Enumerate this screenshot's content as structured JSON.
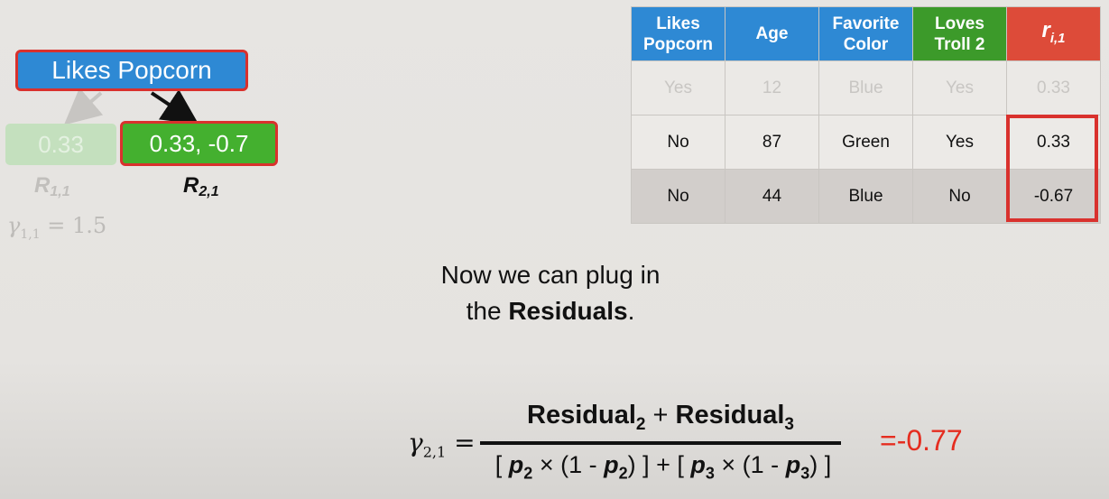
{
  "tree": {
    "root_label": "Likes Popcorn",
    "leaf_left_value": "0.33",
    "leaf_right_value": "0.33, -0.7",
    "leaf_left_name": "R",
    "leaf_left_sub": "1,1",
    "leaf_right_name": "R",
    "leaf_right_sub": "2,1",
    "gamma_left_symbol": "γ",
    "gamma_left_sub": "1,1",
    "gamma_left_value": " = 1.5"
  },
  "table": {
    "headers": [
      {
        "line1": "Likes",
        "line2": "Popcorn",
        "color": "#2e89d4"
      },
      {
        "line1": "Age",
        "line2": "",
        "color": "#2e89d4"
      },
      {
        "line1": "Favorite",
        "line2": "Color",
        "color": "#2e89d4"
      },
      {
        "line1": "Loves",
        "line2": "Troll 2",
        "color": "#3c9a2a"
      },
      {
        "line1": "r",
        "line2": "i,1",
        "color": "#dd4b39"
      }
    ],
    "rows": [
      [
        "Yes",
        "12",
        "Blue",
        "Yes",
        "0.33"
      ],
      [
        "No",
        "87",
        "Green",
        "Yes",
        "0.33"
      ],
      [
        "No",
        "44",
        "Blue",
        "No",
        "-0.67"
      ]
    ]
  },
  "caption": {
    "line1": "Now we can plug in",
    "line2_prefix": "the ",
    "line2_bold": "Residuals",
    "line2_suffix": "."
  },
  "formula": {
    "gamma_symbol": "γ",
    "gamma_sub": "2,1",
    "equals": " =",
    "numerator_a": "Residual",
    "numerator_a_sub": "2",
    "plus": " + ",
    "numerator_b": "Residual",
    "numerator_b_sub": "3",
    "den_open1": "[ ",
    "p": "p",
    "sub2": "2",
    "times1": " × (1 - ",
    "close1": ") ] + [ ",
    "sub3": "3",
    "times2": " × (1 - ",
    "close2": ") ]",
    "result": "=-0.77"
  }
}
